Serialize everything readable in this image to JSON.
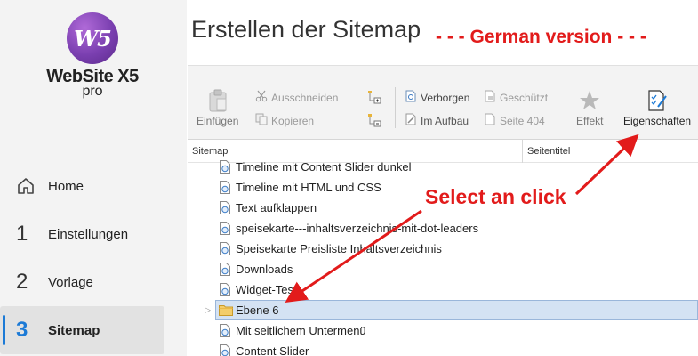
{
  "app": {
    "logo_mark": "W5",
    "name": "WebSite X5",
    "edition": "pro"
  },
  "nav": {
    "items": [
      {
        "num": "",
        "label": "Home",
        "icon": "home-icon"
      },
      {
        "num": "1",
        "label": "Einstellungen"
      },
      {
        "num": "2",
        "label": "Vorlage"
      },
      {
        "num": "3",
        "label": "Sitemap",
        "active": true
      }
    ]
  },
  "header": {
    "title": "Erstellen der Sitemap"
  },
  "annotations": {
    "german": "- - - German version - - -",
    "select": "Select an click"
  },
  "toolbar": {
    "paste": "Einfügen",
    "cut": "Ausschneiden",
    "copy": "Kopieren",
    "hidden": "Verborgen",
    "protected": "Geschützt",
    "under_construction": "Im Aufbau",
    "page404": "Seite 404",
    "effect": "Effekt",
    "properties": "Eigenschaften"
  },
  "tree": {
    "col_sitemap": "Sitemap",
    "col_title": "Seitentitel",
    "rows": [
      {
        "label": "Timeline mit Content Slider dunkel",
        "type": "page"
      },
      {
        "label": "Timeline mit HTML und CSS",
        "type": "page"
      },
      {
        "label": "Text aufklappen",
        "type": "page"
      },
      {
        "label": "speisekarte---inhaltsverzeichnis-mit-dot-leaders",
        "type": "page"
      },
      {
        "label": "Speisekarte Preisliste Inhaltsverzeichnis",
        "type": "page"
      },
      {
        "label": "Downloads",
        "type": "page"
      },
      {
        "label": "Widget-Test",
        "type": "page"
      },
      {
        "label": "Ebene 6",
        "type": "folder",
        "selected": true
      },
      {
        "label": "Mit seitlichem Untermenü",
        "type": "page"
      },
      {
        "label": "Content Slider",
        "type": "page"
      }
    ]
  },
  "colors": {
    "accent": "#1c7ad6",
    "annotation": "#e21b1b",
    "selection": "#d4e2f3",
    "sidebar": "#f3f3f3"
  }
}
